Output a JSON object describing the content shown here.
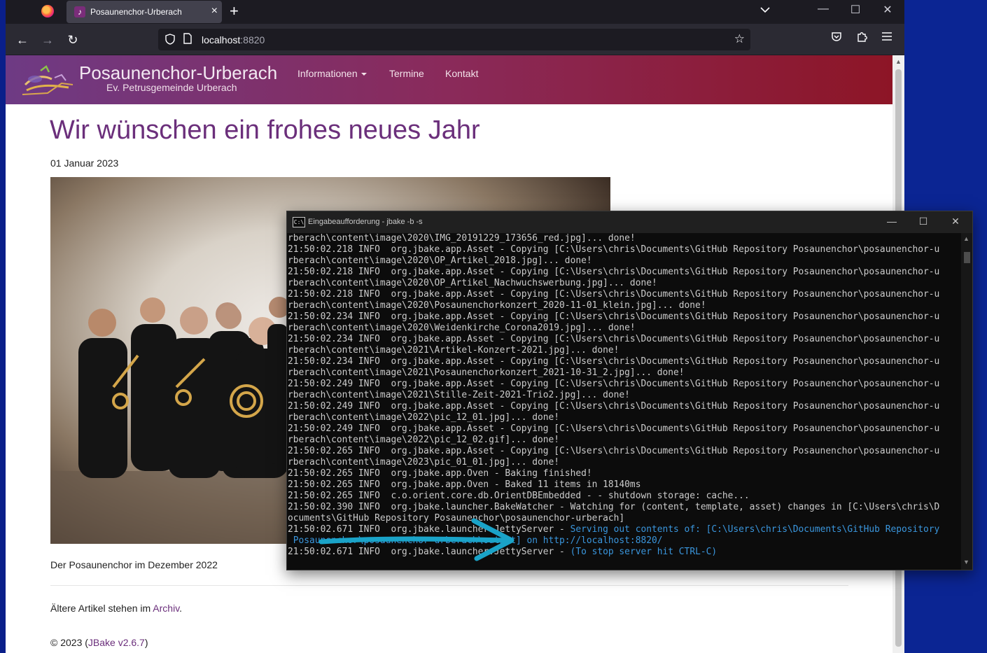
{
  "browser": {
    "tab_title": "Posaunenchor-Urberach",
    "tab_close": "×",
    "new_tab": "+",
    "url_host": "localhost",
    "url_port": ":8820",
    "window_controls": [
      "minimize-icon",
      "maximize-icon",
      "close-icon"
    ]
  },
  "site": {
    "brand_title": "Posaunenchor-Urberach",
    "brand_subtitle": "Ev. Petrusgemeinde Urberach",
    "nav": [
      "Informationen",
      "Termine",
      "Kontakt"
    ],
    "header_gradient": [
      "#6e3a84",
      "#8d1526"
    ],
    "accent_color": "#6b2f7b"
  },
  "article": {
    "title": "Wir wünschen ein frohes neues Jahr",
    "date": "01 Januar 2023",
    "caption": "Der Posaunenchor im Dezember 2022",
    "older_prefix": "Ältere Artikel stehen im ",
    "older_link": "Archiv",
    "older_suffix": ".",
    "footer_prefix": "© 2023 (",
    "footer_link": "JBake v2.6.7",
    "footer_suffix": ")"
  },
  "console": {
    "title": "Eingabeaufforderung - jbake  -b -s",
    "lines": [
      "rberach\\content\\image\\2020\\IMG_20191229_173656_red.jpg]... done!",
      "21:50:02.218 INFO  org.jbake.app.Asset - Copying [C:\\Users\\chris\\Documents\\GitHub Repository Posaunenchor\\posaunenchor-u",
      "rberach\\content\\image\\2020\\OP_Artikel_2018.jpg]... done!",
      "21:50:02.218 INFO  org.jbake.app.Asset - Copying [C:\\Users\\chris\\Documents\\GitHub Repository Posaunenchor\\posaunenchor-u",
      "rberach\\content\\image\\2020\\OP_Artikel_Nachwuchswerbung.jpg]... done!",
      "21:50:02.218 INFO  org.jbake.app.Asset - Copying [C:\\Users\\chris\\Documents\\GitHub Repository Posaunenchor\\posaunenchor-u",
      "rberach\\content\\image\\2020\\Posaunenchorkonzert_2020-11-01_klein.jpg]... done!",
      "21:50:02.234 INFO  org.jbake.app.Asset - Copying [C:\\Users\\chris\\Documents\\GitHub Repository Posaunenchor\\posaunenchor-u",
      "rberach\\content\\image\\2020\\Weidenkirche_Corona2019.jpg]... done!",
      "21:50:02.234 INFO  org.jbake.app.Asset - Copying [C:\\Users\\chris\\Documents\\GitHub Repository Posaunenchor\\posaunenchor-u",
      "rberach\\content\\image\\2021\\Artikel-Konzert-2021.jpg]... done!",
      "21:50:02.234 INFO  org.jbake.app.Asset - Copying [C:\\Users\\chris\\Documents\\GitHub Repository Posaunenchor\\posaunenchor-u",
      "rberach\\content\\image\\2021\\Posaunenchorkonzert_2021-10-31_2.jpg]... done!",
      "21:50:02.249 INFO  org.jbake.app.Asset - Copying [C:\\Users\\chris\\Documents\\GitHub Repository Posaunenchor\\posaunenchor-u",
      "rberach\\content\\image\\2021\\Stille-Zeit-2021-Trio2.jpg]... done!",
      "21:50:02.249 INFO  org.jbake.app.Asset - Copying [C:\\Users\\chris\\Documents\\GitHub Repository Posaunenchor\\posaunenchor-u",
      "rberach\\content\\image\\2022\\pic_12_01.jpg]... done!",
      "21:50:02.249 INFO  org.jbake.app.Asset - Copying [C:\\Users\\chris\\Documents\\GitHub Repository Posaunenchor\\posaunenchor-u",
      "rberach\\content\\image\\2022\\pic_12_02.gif]... done!",
      "21:50:02.265 INFO  org.jbake.app.Asset - Copying [C:\\Users\\chris\\Documents\\GitHub Repository Posaunenchor\\posaunenchor-u",
      "rberach\\content\\image\\2023\\pic_01_01.jpg]... done!",
      "21:50:02.265 INFO  org.jbake.app.Oven - Baking finished!",
      "21:50:02.265 INFO  org.jbake.app.Oven - Baked 11 items in 18140ms",
      "21:50:02.265 INFO  c.o.orient.core.db.OrientDBEmbedded - - shutdown storage: cache...",
      "21:50:02.390 INFO  org.jbake.launcher.BakeWatcher - Watching for (content, template, asset) changes in [C:\\Users\\chris\\D",
      "ocuments\\GitHub Repository Posaunenchor\\posaunenchor-urberach]",
      "21:50:02.671 INFO  org.jbake.launcher.JettyServer - Serving out contents of: [C:\\Users\\chris\\Documents\\GitHub Repository",
      " Posaunenchor\\posaunenchor-urberach\\output] on http://localhost:8820/",
      "21:50:02.671 INFO  org.jbake.launcher.JettyServer - (To stop server hit CTRL-C)"
    ],
    "arrow_color": "#1aa3c8"
  }
}
